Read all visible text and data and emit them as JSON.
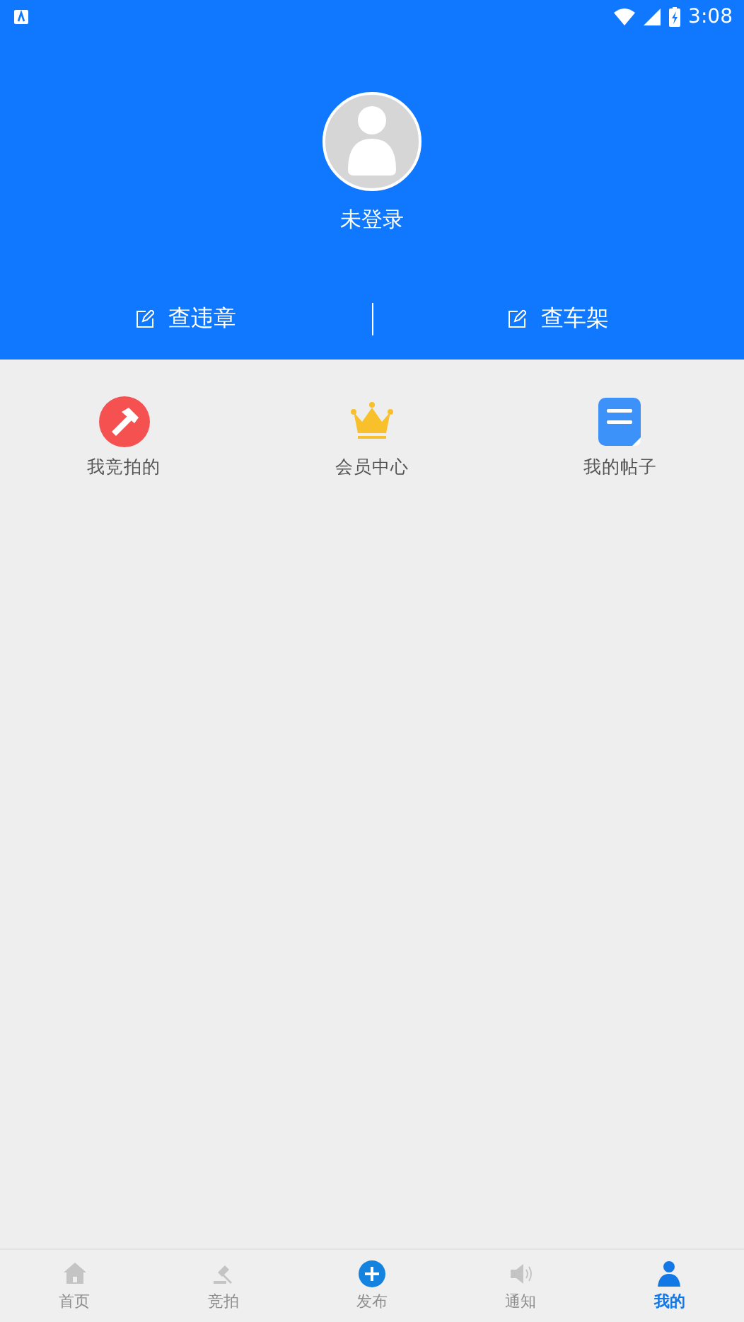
{
  "status_bar": {
    "time": "3:08"
  },
  "profile": {
    "name": "未登录"
  },
  "quick_actions": [
    {
      "label": "查违章"
    },
    {
      "label": "查车架"
    }
  ],
  "menu": [
    {
      "kind": "hammer",
      "label": "我竞拍的"
    },
    {
      "kind": "crown",
      "label": "会员中心"
    },
    {
      "kind": "posts",
      "label": "我的帖子"
    }
  ],
  "tab_bar": [
    {
      "kind": "home",
      "label": "首页",
      "selected": false
    },
    {
      "kind": "gavel",
      "label": "竞拍",
      "selected": false
    },
    {
      "kind": "plus",
      "label": "发布",
      "selected": false
    },
    {
      "kind": "speaker",
      "label": "通知",
      "selected": false
    },
    {
      "kind": "person",
      "label": "我的",
      "selected": true
    }
  ]
}
